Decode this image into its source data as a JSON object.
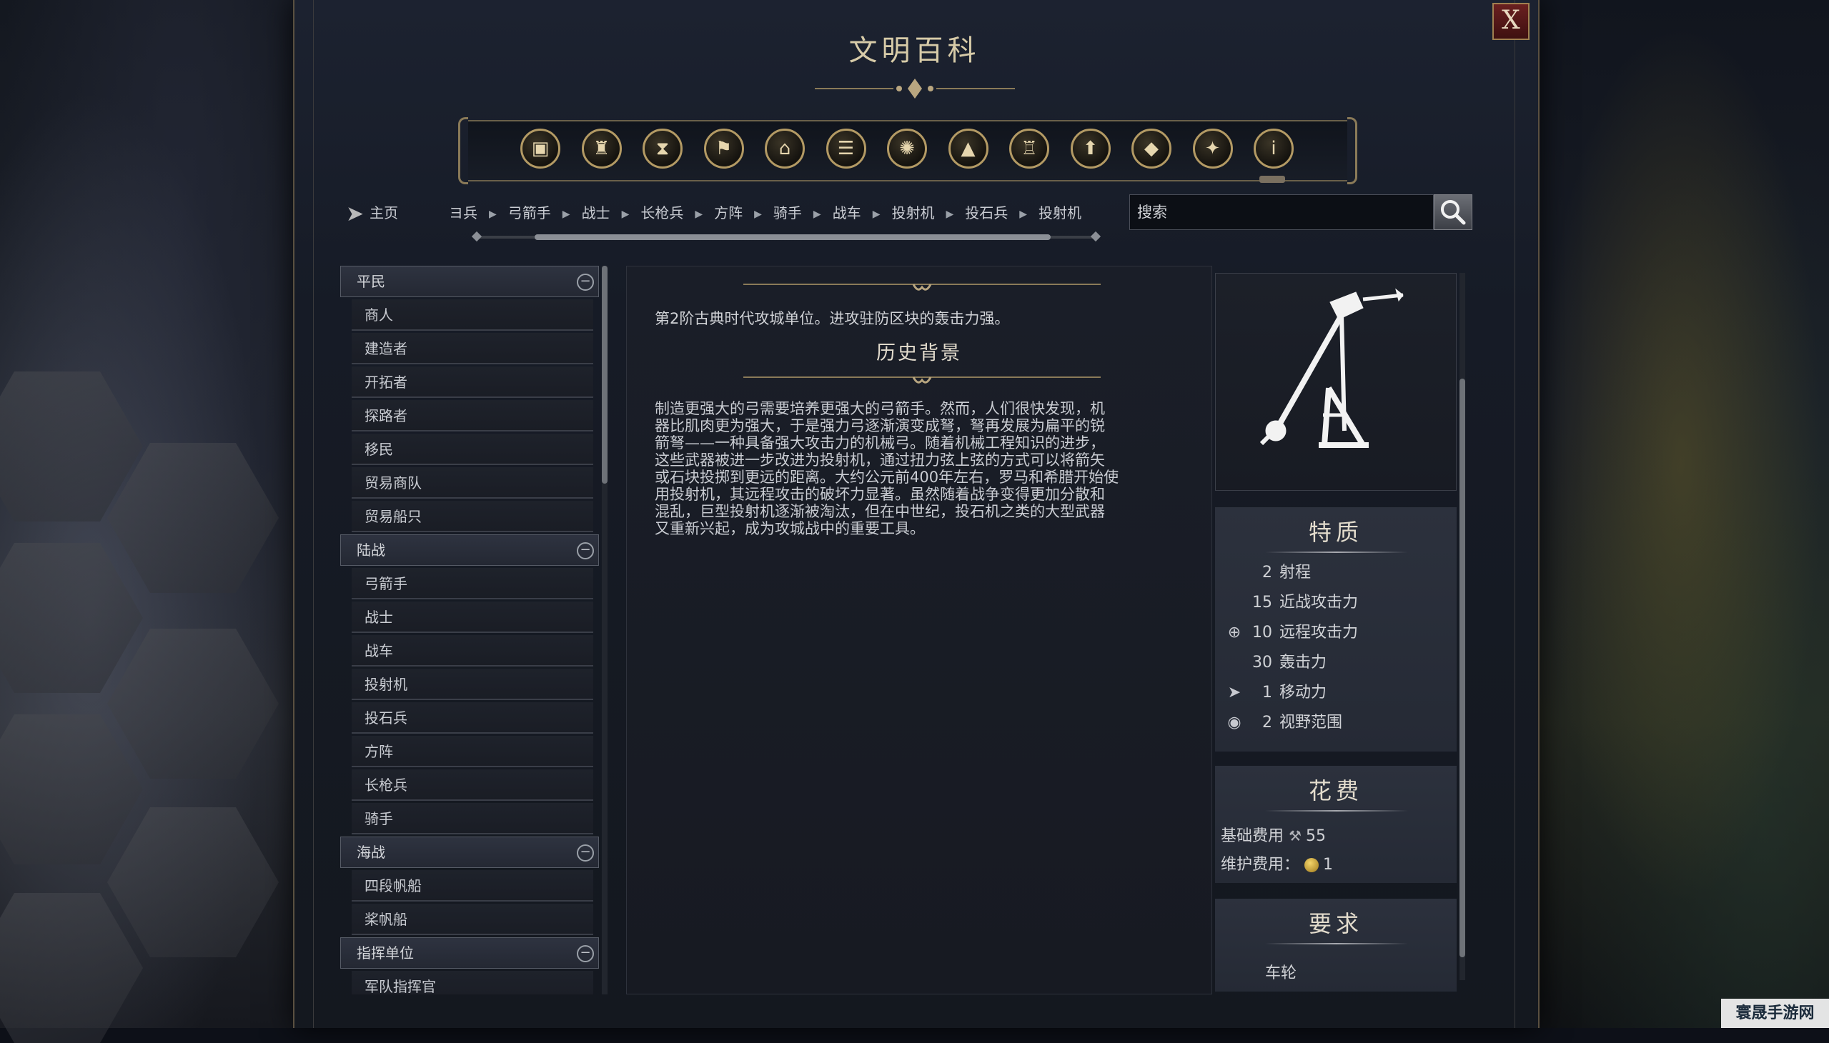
{
  "window": {
    "title": "文明百科",
    "close_label": "X"
  },
  "category_icons": [
    {
      "name": "units-icon",
      "glyph": "▣"
    },
    {
      "name": "government-icon",
      "glyph": "♜"
    },
    {
      "name": "eras-icon",
      "glyph": "⧗"
    },
    {
      "name": "flag-icon",
      "glyph": "⚑"
    },
    {
      "name": "building-icon",
      "glyph": "⌂"
    },
    {
      "name": "book-icon",
      "glyph": "☰"
    },
    {
      "name": "science-icon",
      "glyph": "✺"
    },
    {
      "name": "terrain-icon",
      "glyph": "▲"
    },
    {
      "name": "city-icon",
      "glyph": "♖"
    },
    {
      "name": "improvement-icon",
      "glyph": "⬆"
    },
    {
      "name": "resource-icon",
      "glyph": "◆"
    },
    {
      "name": "religion-icon",
      "glyph": "✦"
    },
    {
      "name": "info-icon",
      "glyph": "i"
    }
  ],
  "nav": {
    "home_label": "主页",
    "breadcrumbs": [
      "ヨ兵",
      "弓箭手",
      "战士",
      "长枪兵",
      "方阵",
      "骑手",
      "战车",
      "投射机",
      "投石兵",
      "投射机"
    ],
    "search_placeholder": "搜索"
  },
  "sidebar": {
    "groups": [
      {
        "label": "平民",
        "items": [
          "商人",
          "建造者",
          "开拓者",
          "探路者",
          "移民",
          "贸易商队",
          "贸易船只"
        ]
      },
      {
        "label": "陆战",
        "items": [
          "弓箭手",
          "战士",
          "战车",
          "投射机",
          "投石兵",
          "方阵",
          "长枪兵",
          "骑手"
        ]
      },
      {
        "label": "海战",
        "items": [
          "四段帆船",
          "桨帆船"
        ]
      },
      {
        "label": "指挥单位",
        "items": [
          "军队指挥官"
        ]
      }
    ]
  },
  "article": {
    "summary": "第2阶古典时代攻城单位。进攻驻防区块的轰击力强。",
    "history_title": "历史背景",
    "history_lines": [
      "制造更强大的弓需要培养更强大的弓箭手。然而，人们很快发现，机",
      "器比肌肉更为强大，于是强力弓逐渐演变成弩，弩再发展为扁平的锐",
      "箭弩——一种具备强大攻击力的机械弓。随着机械工程知识的进步，",
      "这些武器被进一步改进为投射机，通过扭力弦上弦的方式可以将箭矢",
      "或石块投掷到更远的距离。大约公元前400年左右，罗马和希腊开始使",
      "用投射机，其远程攻击的破坏力显著。虽然随着战争变得更加分散和",
      "混乱，巨型投射机逐渐被淘汰，但在中世纪，投石机之类的大型武器",
      "又重新兴起，成为攻城战中的重要工具。"
    ]
  },
  "traits": {
    "title": "特质",
    "rows": [
      {
        "icon": "",
        "value": "2",
        "label": "射程"
      },
      {
        "icon": "",
        "value": "15",
        "label": "近战攻击力"
      },
      {
        "icon": "⊕",
        "value": "10",
        "label": "远程攻击力"
      },
      {
        "icon": "",
        "value": "30",
        "label": "轰击力"
      },
      {
        "icon": "➤",
        "value": "1",
        "label": "移动力"
      },
      {
        "icon": "◉",
        "value": "2",
        "label": "视野范围"
      }
    ]
  },
  "cost": {
    "title": "花费",
    "base_label": "基础费用",
    "base_value": "55",
    "upkeep_label": "维护费用：",
    "upkeep_value": "1"
  },
  "requirements": {
    "title": "要求",
    "items": [
      "车轮"
    ]
  },
  "watermark": "寰晟手游网",
  "colors": {
    "gold_accent": "#b39a64",
    "close_red": "#6a2020"
  }
}
